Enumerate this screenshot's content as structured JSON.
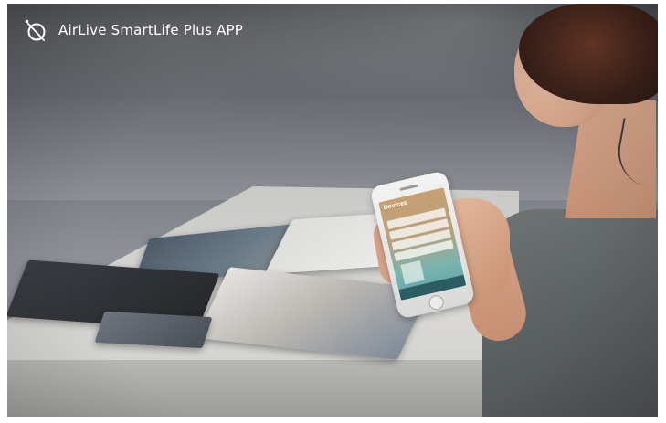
{
  "banner": {
    "title": "AirLive SmartLife Plus APP",
    "logo_icon": "airlive-logo-icon"
  },
  "phone_screen": {
    "header_label": "Devices"
  },
  "colors": {
    "title_text": "#ffffff",
    "screen_top": "#c6a071",
    "screen_bottom": "#5ea7a6",
    "shirt": "#5b6061"
  }
}
